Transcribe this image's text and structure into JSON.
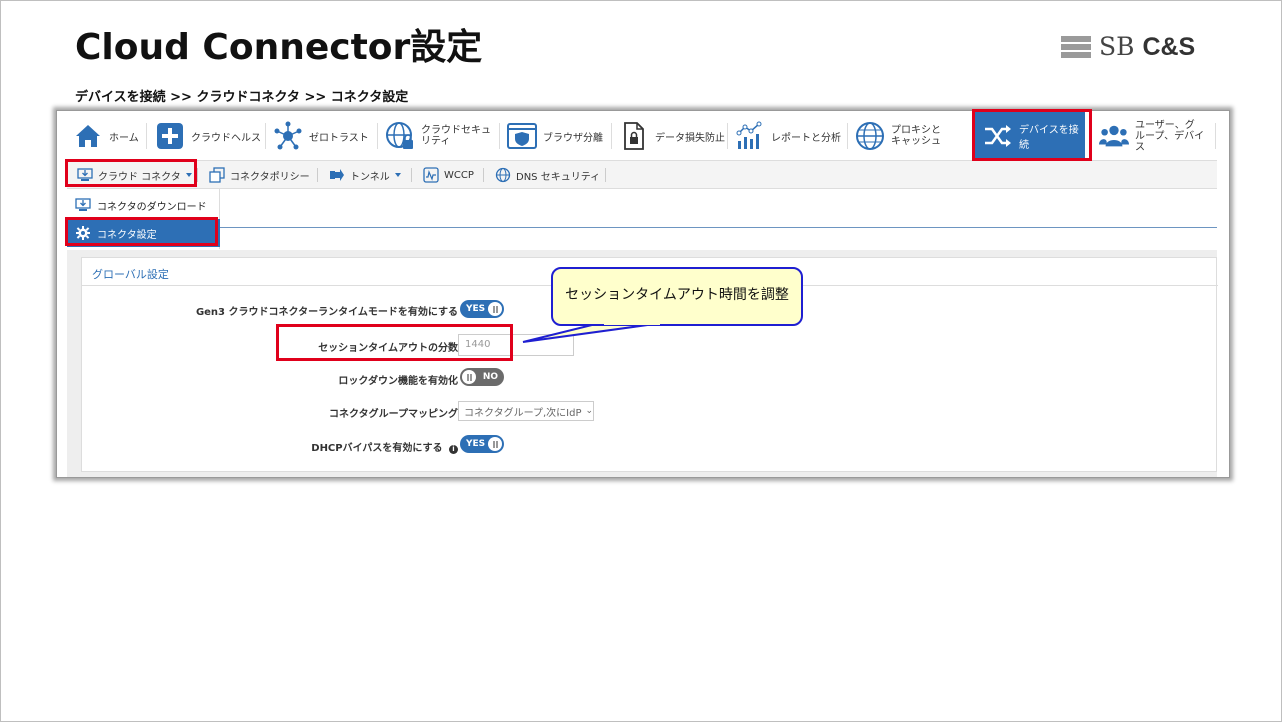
{
  "slide": {
    "title": "Cloud Connector設定",
    "breadcrumb": "デバイスを接続 >> クラウドコネクタ >> コネクタ設定",
    "logo_sb": "SB",
    "logo_cs": "C&S"
  },
  "topnav": {
    "items": [
      {
        "label": "ホーム",
        "icon": "home-icon"
      },
      {
        "label": "クラウドヘルス",
        "icon": "plus-icon"
      },
      {
        "label": "ゼロトラスト",
        "icon": "network-icon"
      },
      {
        "label_line1": "クラウドセキュ",
        "label_line2": "リティ",
        "icon": "globe-lock-icon"
      },
      {
        "label": "ブラウザ分離",
        "icon": "browser-shield-icon"
      },
      {
        "label": "データ損失防止",
        "icon": "document-lock-icon"
      },
      {
        "label": "レポートと分析",
        "icon": "analytics-icon"
      },
      {
        "label_line1": "プロキシと",
        "label_line2": "キャッシュ",
        "icon": "globe-icon"
      },
      {
        "label": "デバイスを接続",
        "icon": "shuffle-icon",
        "active": true
      },
      {
        "label_line1": "ユーザー、グ",
        "label_line2": "ループ、デバイ",
        "label_line3": "ス",
        "icon": "users-icon"
      }
    ]
  },
  "subnav": {
    "items": [
      {
        "label": "クラウド コネクタ",
        "icon": "download-monitor-icon",
        "has_caret": true
      },
      {
        "label": "コネクタポリシー",
        "icon": "policy-icon"
      },
      {
        "label": "トンネル",
        "icon": "tunnel-icon",
        "has_caret": true
      },
      {
        "label": "WCCP",
        "icon": "wccp-icon"
      },
      {
        "label": "DNS セキュリティ",
        "icon": "dns-globe-icon"
      }
    ]
  },
  "dropdown": {
    "items": [
      {
        "label": "コネクタのダウンロード",
        "icon": "download-monitor-icon"
      },
      {
        "label": "コネクタ設定",
        "icon": "gear-icon",
        "active": true
      }
    ]
  },
  "panel": {
    "title": "グローバル設定",
    "rows": {
      "gen3": {
        "label": "Gen3 クラウドコネクターランタイムモードを有効にする",
        "toggle": "YES"
      },
      "session_timeout": {
        "label": "セッションタイムアウトの分数",
        "value": "1440"
      },
      "lockdown": {
        "label": "ロックダウン機能を有効化",
        "toggle": "NO"
      },
      "group_mapping": {
        "label": "コネクタグループマッピング",
        "value": "コネクタグループ,次にIdP"
      },
      "dhcp": {
        "label": "DHCPバイパスを有効にする",
        "toggle": "YES"
      }
    }
  },
  "callout": {
    "text": "セッションタイムアウト時間を調整"
  },
  "colors": {
    "accent": "#2d6fb5",
    "highlight": "#e0001b",
    "callout_border": "#1f1fd1",
    "callout_fill": "#ffffcc"
  }
}
